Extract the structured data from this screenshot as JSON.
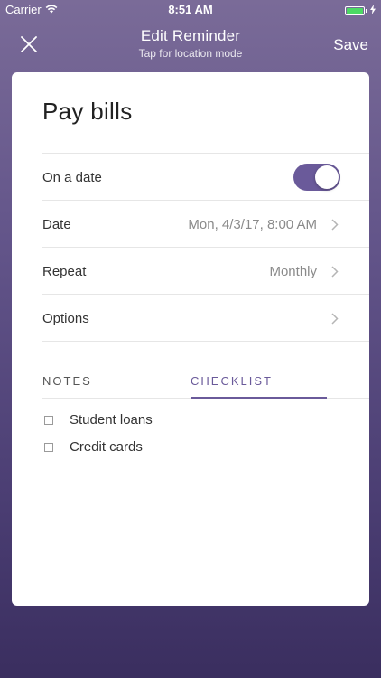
{
  "status_bar": {
    "carrier": "Carrier",
    "time": "8:51 AM",
    "battery_level": 1.0,
    "battery_color": "#4cd964"
  },
  "header": {
    "title": "Edit Reminder",
    "subtitle": "Tap for location mode",
    "save_label": "Save",
    "close_icon": "close-icon"
  },
  "reminder": {
    "title": "Pay bills"
  },
  "rows": {
    "on_a_date": {
      "label": "On a date",
      "toggle_on": true
    },
    "date": {
      "label": "Date",
      "value": "Mon, 4/3/17, 8:00 AM"
    },
    "repeat": {
      "label": "Repeat",
      "value": "Monthly"
    },
    "options": {
      "label": "Options"
    }
  },
  "tabs": {
    "notes": "NOTES",
    "checklist": "CHECKLIST",
    "active": "checklist"
  },
  "checklist": [
    {
      "label": "Student loans",
      "checked": false
    },
    {
      "label": "Credit cards",
      "checked": false
    }
  ],
  "colors": {
    "accent": "#6a5a9a",
    "background_top": "#7a6b98",
    "background_bottom": "#3a2e5f"
  }
}
